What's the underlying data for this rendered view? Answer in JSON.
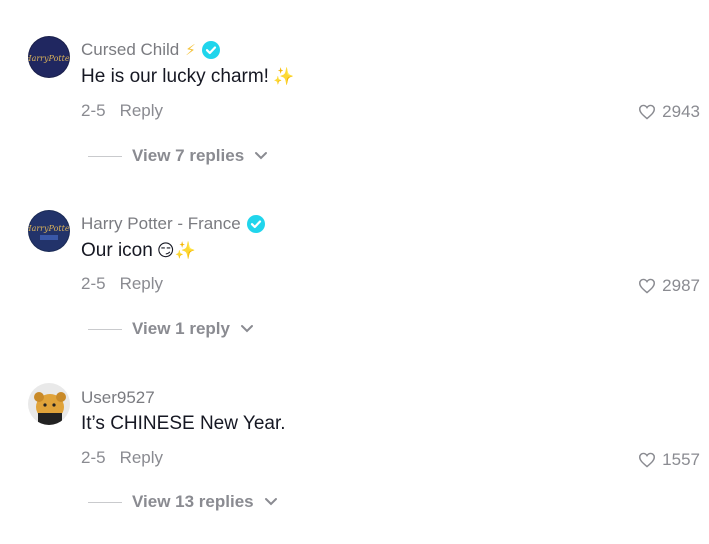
{
  "comments": [
    {
      "username": "Cursed Child",
      "has_bolt": true,
      "verified": true,
      "text": "He is our lucky charm!",
      "emoji": "✨",
      "date": "2-5",
      "reply_label": "Reply",
      "likes": "2943",
      "view_replies": "View 7 replies",
      "avatar": {
        "name": "harry-potter-logo-avatar",
        "bg": "#1a1f4a",
        "logo_text": "HarryPotter",
        "accent": "#c9a24a"
      }
    },
    {
      "username": "Harry Potter - France",
      "has_bolt": false,
      "verified": true,
      "text": "Our icon",
      "emoji": "😏✨",
      "date": "2-5",
      "reply_label": "Reply",
      "likes": "2987",
      "view_replies": "View 1 reply",
      "avatar": {
        "name": "harry-potter-france-avatar",
        "bg": "#1a2a55",
        "logo_text": "HarryPotter",
        "accent": "#c9a24a"
      }
    },
    {
      "username": "User9527",
      "has_bolt": false,
      "verified": false,
      "text": "It’s CHINESE New Year.",
      "emoji": "",
      "date": "2-5",
      "reply_label": "Reply",
      "likes": "1557",
      "view_replies": "View 13 replies",
      "avatar": {
        "name": "cartoon-bear-avatar",
        "bg": "#2b2b2b",
        "accent": "#e0a33a"
      }
    }
  ],
  "colors": {
    "verified": "#20d5ec",
    "muted": "#8a8b91",
    "text": "#161823"
  }
}
